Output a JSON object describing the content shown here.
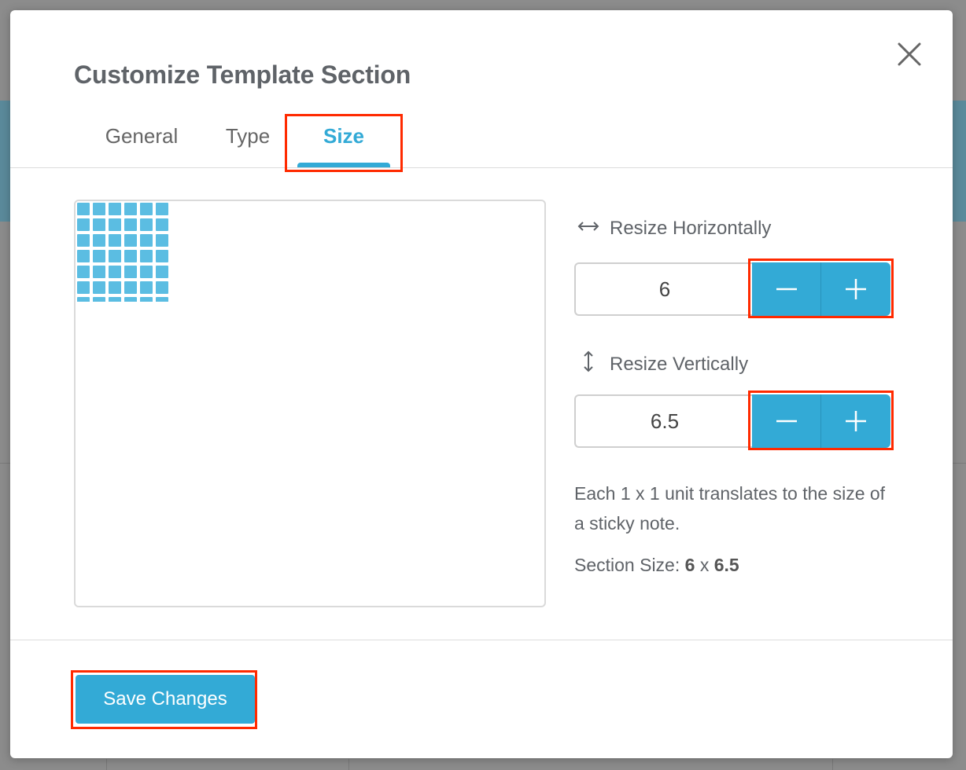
{
  "dialog": {
    "title": "Customize Template Section",
    "close_icon": "close-icon"
  },
  "tabs": [
    {
      "label": "General",
      "active": false
    },
    {
      "label": "Type",
      "active": false
    },
    {
      "label": "Size",
      "active": true
    }
  ],
  "preview": {
    "columns": 6,
    "rows": 6.5,
    "cell_color": "#5bbde2"
  },
  "resize": {
    "horizontal": {
      "label": "Resize Horizontally",
      "icon": "horizontal-arrows-icon",
      "value": "6",
      "decrement": "−",
      "increment": "+"
    },
    "vertical": {
      "label": "Resize Vertically",
      "icon": "vertical-arrows-icon",
      "value": "6.5",
      "decrement": "−",
      "increment": "+"
    }
  },
  "info": {
    "unit_note": "Each 1 x 1 unit translates to the size of a sticky note.",
    "section_size_label": "Section Size:",
    "section_size_width": "6",
    "section_size_separator": "x",
    "section_size_height": "6.5"
  },
  "footer": {
    "save_label": "Save Changes"
  },
  "colors": {
    "accent": "#33aad6",
    "highlight": "#ff2a00",
    "title_text": "#5f6368"
  }
}
